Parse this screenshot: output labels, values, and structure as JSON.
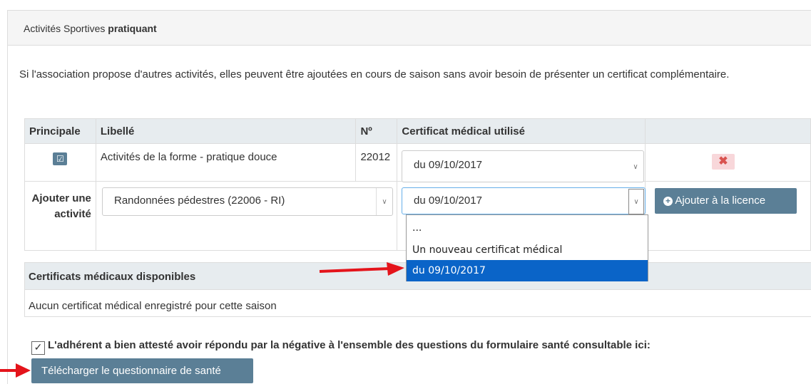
{
  "panel": {
    "title_prefix": "Activités Sportives ",
    "title_bold": "pratiquant",
    "intro": "Si l'association propose d'autres activités, elles peuvent être ajoutées en cours de saison sans avoir besoin de présenter un certificat complémentaire."
  },
  "table": {
    "headers": [
      "Principale",
      "Libellé",
      "Nº",
      "Certificat médical utilisé",
      ""
    ],
    "row": {
      "label": "Activités de la forme - pratique douce",
      "number": "22012",
      "certificate": "du 09/10/2017",
      "delete_icon": "✖"
    },
    "add_row": {
      "label": "Ajouter une activité",
      "activity_value": "Randonnées pédestres (22006 - RI)",
      "certificate_value": "du 09/10/2017",
      "button_label": "Ajouter à la licence",
      "button_icon": "plus-circle-icon"
    }
  },
  "dropdown": {
    "options": [
      "...",
      "Un nouveau certificat médical",
      "du 09/10/2017"
    ],
    "selected": "du 09/10/2017"
  },
  "certificates": {
    "title": "Certificats médicaux disponibles",
    "empty_text": "Aucun certificat médical enregistré pour cette saison"
  },
  "attestation": {
    "text": "L'adhérent a bien attesté avoir répondu par la négative à l'ensemble des questions du formulaire santé consultable ici:",
    "checked": true,
    "download_label": "Télécharger le questionnaire de santé"
  },
  "colors": {
    "accent": "#5b7f96",
    "selection": "#0a64c8",
    "arrow": "#e4141b"
  }
}
